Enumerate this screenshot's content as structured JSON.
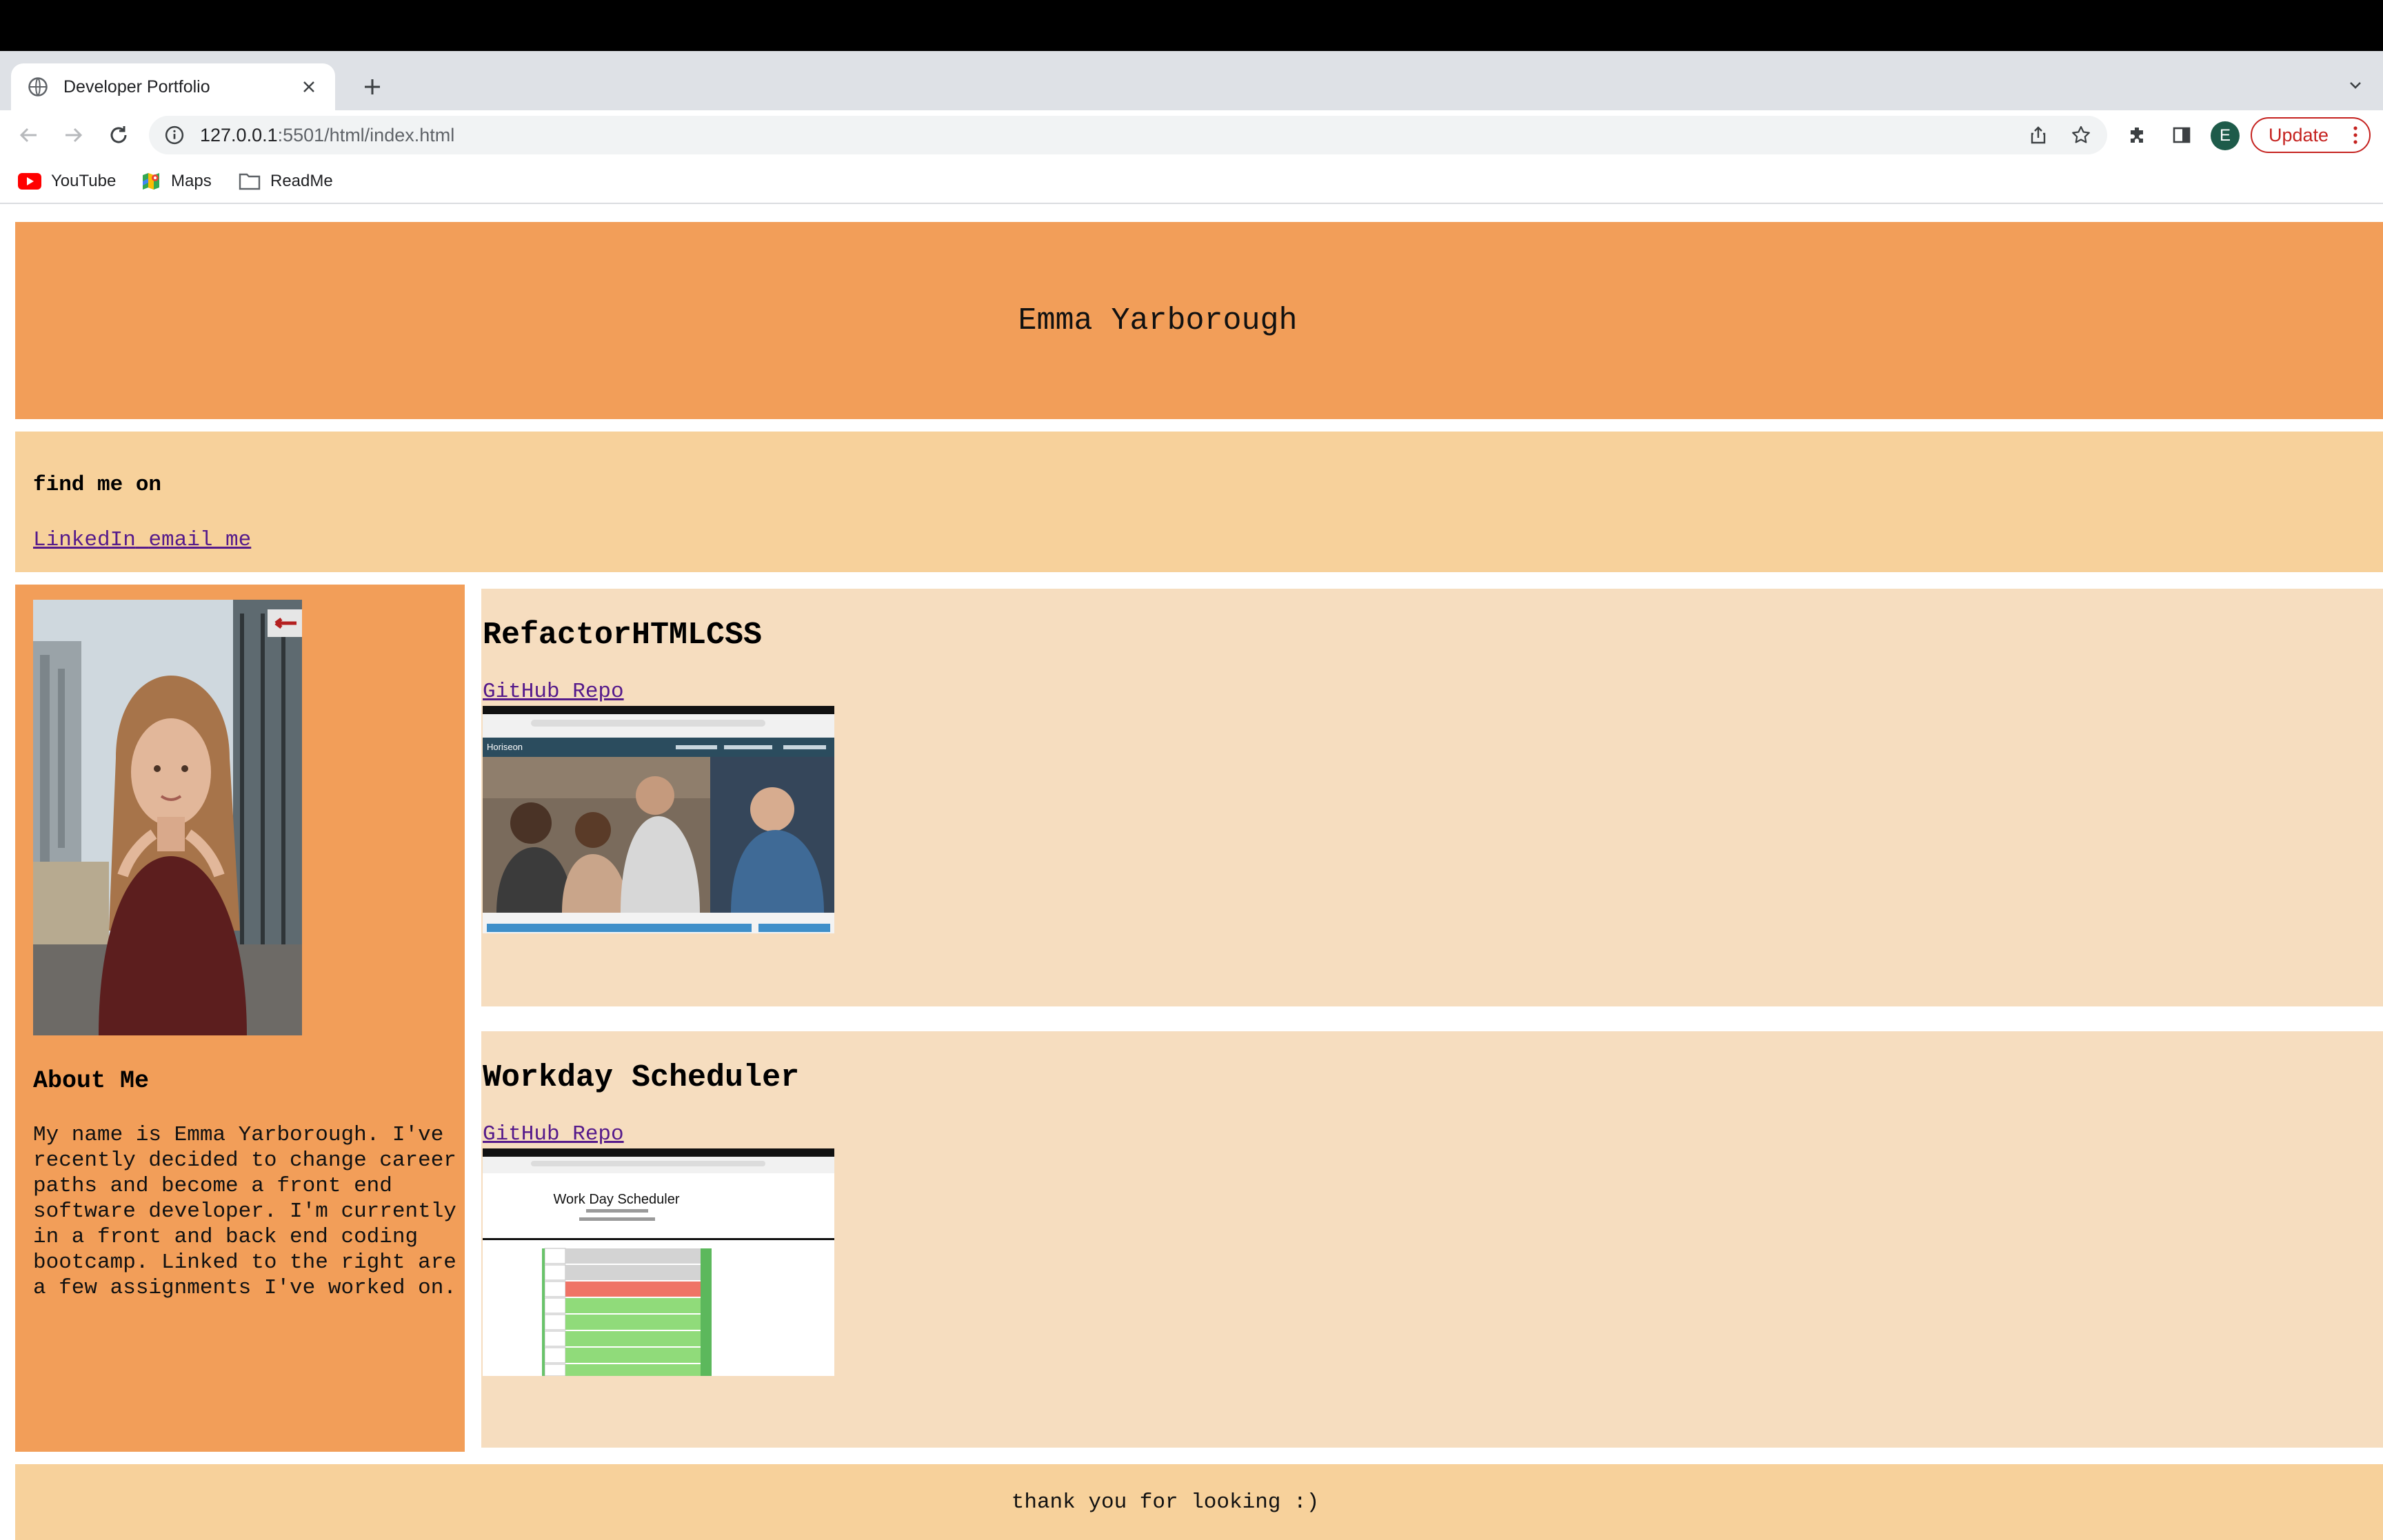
{
  "browser": {
    "tab_title": "Developer Portfolio",
    "url_host": "127.0.0.1",
    "url_path": ":5501/html/index.html",
    "avatar_letter": "E",
    "update_label": "Update",
    "bookmarks": [
      {
        "label": "YouTube",
        "icon": "youtube-icon"
      },
      {
        "label": "Maps",
        "icon": "maps-icon"
      },
      {
        "label": "ReadMe",
        "icon": "folder-icon"
      }
    ]
  },
  "page": {
    "header_name": "Emma Yarborough",
    "contact_heading": "find me on",
    "contact_links": [
      "LinkedIn",
      "email me"
    ],
    "about_heading": "About Me",
    "about_text": "My name is Emma Yarborough. I've recently decided to change career paths and become a front end software developer. I'm currently in a front and back end coding bootcamp. Linked to the right are a few assignments I've worked on.",
    "projects": [
      {
        "title": "RefactorHTMLCSS",
        "link": "GitHub Repo",
        "site_brand": "Horiseon"
      },
      {
        "title": "Workday Scheduler",
        "link": "GitHub Repo",
        "site_title": "Work Day Scheduler"
      }
    ],
    "footer_text": "thank you for looking :)"
  },
  "colors": {
    "header_bg": "#f29e59",
    "contact_bg": "#f7d19b",
    "project_bg": "#f6ddbf",
    "link": "#551a8b",
    "update_red": "#c5221f"
  }
}
